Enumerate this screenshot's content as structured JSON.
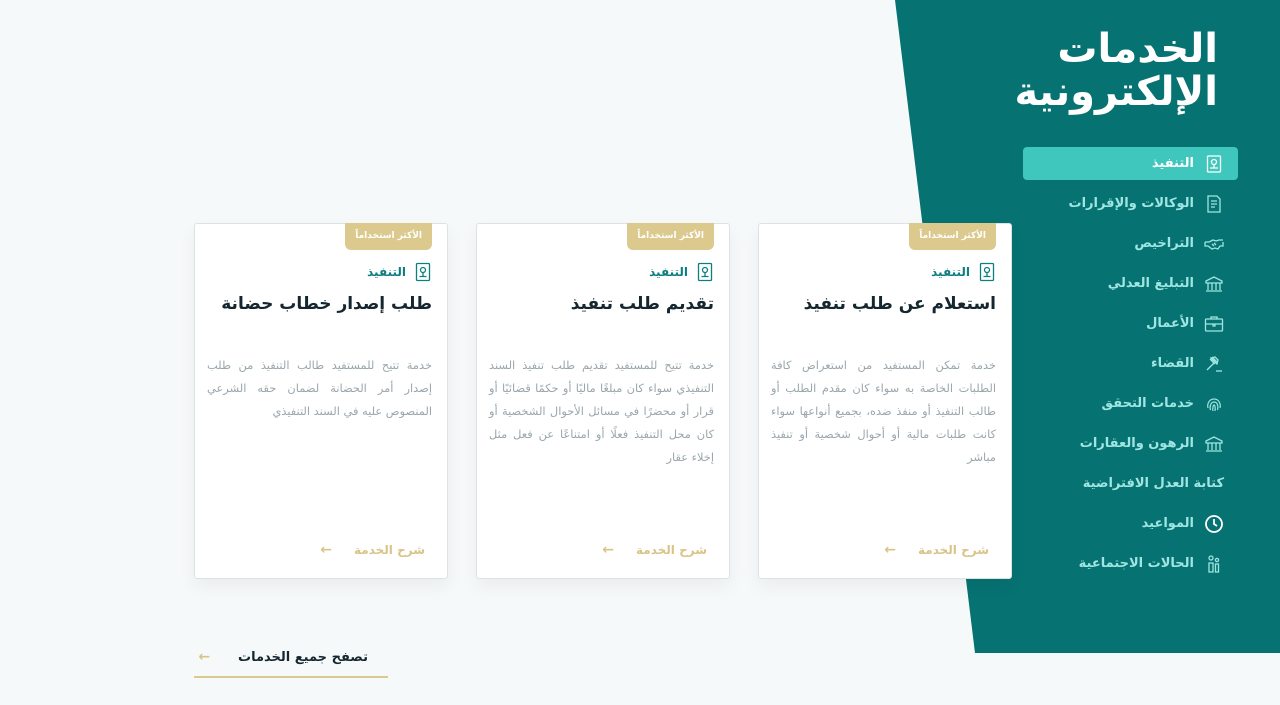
{
  "sidebar": {
    "heading_line1": "الخدمات",
    "heading_line2": "الإلكترونية",
    "items": [
      {
        "label": "التنفيذ",
        "icon": "document-icon",
        "active": true
      },
      {
        "label": "الوكالات والإقرارات",
        "icon": "form-icon",
        "active": false
      },
      {
        "label": "التراخيص",
        "icon": "handshake-icon",
        "active": false
      },
      {
        "label": "التبليغ العدلي",
        "icon": "building-icon",
        "active": false
      },
      {
        "label": "الأعمال",
        "icon": "briefcase-icon",
        "active": false
      },
      {
        "label": "القضاء",
        "icon": "gavel-icon",
        "active": false
      },
      {
        "label": "خدمات التحقق",
        "icon": "fingerprint-icon",
        "active": false
      },
      {
        "label": "الرهون والعقارات",
        "icon": "building-icon",
        "active": false
      },
      {
        "label": "كتابة العدل الافتراضية",
        "icon": "",
        "active": false
      },
      {
        "label": "المواعيد",
        "icon": "clock-icon",
        "active": false
      },
      {
        "label": "الحالات الاجتماعية",
        "icon": "family-icon",
        "active": false
      }
    ]
  },
  "cards": [
    {
      "badge": "الأكثر استخداماً",
      "category": "التنفيذ",
      "title": "استعلام عن طلب تنفيذ",
      "description": "خدمة تمكن المستفيد من استعراض كافة الطلبات الخاصة به سواء كان مقدم الطلب أو طالب التنفيذ أو منفذ ضده، بجميع أنواعها سواء كانت طلبات مالية أو أحوال شخصية أو تنفيذ مباشر",
      "link": "شرح الخدمة"
    },
    {
      "badge": "الأكثر استخداماً",
      "category": "التنفيذ",
      "title": "تقديم طلب تنفيذ",
      "description": "خدمة تتيح للمستفيد تقديم طلب تنفيذ السند التنفيذي سواء كان مبلغًا ماليًا أو حكمًا قضائيًا أو قرار أو محضرًا في مسائل الأحوال الشخصية أو كان محل التنفيذ فعلًا أو امتناعًا عن فعل مثل إخلاء عقار",
      "link": "شرح الخدمة"
    },
    {
      "badge": "الأكثر استخداماً",
      "category": "التنفيذ",
      "title": "طلب إصدار خطاب حضانة",
      "description": "خدمة تتيح للمستفيد طالب التنفيذ من طلب إصدار أمر الحضانة لضمان حقه الشرعي المنصوص عليه في السند التنفيذي",
      "link": "شرح الخدمة"
    }
  ],
  "browse_all": "تصفح جميع الخدمات",
  "colors": {
    "teal_dark": "#077272",
    "teal_active": "#3fc7bd",
    "gold": "#dcc98e",
    "background": "#f6f9fa"
  }
}
